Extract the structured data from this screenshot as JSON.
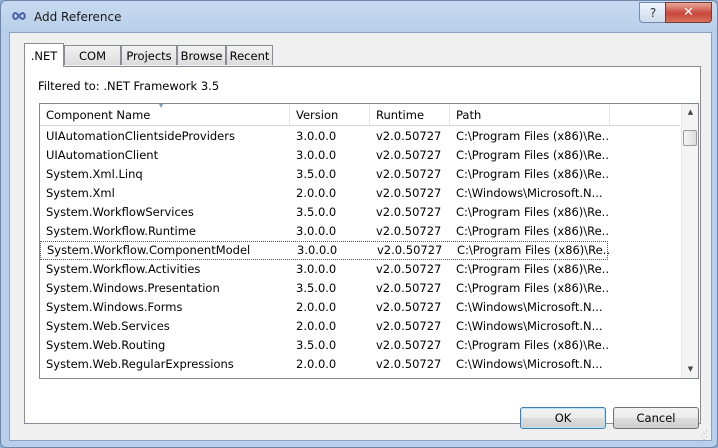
{
  "window": {
    "title": "Add Reference",
    "help_label": "?",
    "close_label": "✕"
  },
  "tabs": [
    {
      "label": ".NET",
      "active": true
    },
    {
      "label": "COM",
      "active": false
    },
    {
      "label": "Projects",
      "active": false
    },
    {
      "label": "Browse",
      "active": false
    },
    {
      "label": "Recent",
      "active": false
    }
  ],
  "filter_text": "Filtered to: .NET Framework 3.5",
  "list": {
    "columns": [
      "Component Name",
      "Version",
      "Runtime",
      "Path"
    ],
    "rows": [
      [
        "UIAutomationClientsideProviders",
        "3.0.0.0",
        "v2.0.50727",
        "C:\\Program Files (x86)\\Re..."
      ],
      [
        "UIAutomationClient",
        "3.0.0.0",
        "v2.0.50727",
        "C:\\Program Files (x86)\\Re..."
      ],
      [
        "System.Xml.Linq",
        "3.5.0.0",
        "v2.0.50727",
        "C:\\Program Files (x86)\\Re..."
      ],
      [
        "System.Xml",
        "2.0.0.0",
        "v2.0.50727",
        "C:\\Windows\\Microsoft.N..."
      ],
      [
        "System.WorkflowServices",
        "3.5.0.0",
        "v2.0.50727",
        "C:\\Program Files (x86)\\Re..."
      ],
      [
        "System.Workflow.Runtime",
        "3.0.0.0",
        "v2.0.50727",
        "C:\\Program Files (x86)\\Re..."
      ],
      [
        "System.Workflow.ComponentModel",
        "3.0.0.0",
        "v2.0.50727",
        "C:\\Program Files (x86)\\Re..."
      ],
      [
        "System.Workflow.Activities",
        "3.0.0.0",
        "v2.0.50727",
        "C:\\Program Files (x86)\\Re..."
      ],
      [
        "System.Windows.Presentation",
        "3.5.0.0",
        "v2.0.50727",
        "C:\\Program Files (x86)\\Re..."
      ],
      [
        "System.Windows.Forms",
        "2.0.0.0",
        "v2.0.50727",
        "C:\\Windows\\Microsoft.N..."
      ],
      [
        "System.Web.Services",
        "2.0.0.0",
        "v2.0.50727",
        "C:\\Windows\\Microsoft.N..."
      ],
      [
        "System.Web.Routing",
        "3.5.0.0",
        "v2.0.50727",
        "C:\\Program Files (x86)\\Re..."
      ],
      [
        "System.Web.RegularExpressions",
        "2.0.0.0",
        "v2.0.50727",
        "C:\\Windows\\Microsoft.N..."
      ]
    ],
    "selected_index": 6,
    "sorted_column": "Component Name"
  },
  "buttons": {
    "ok": "OK",
    "cancel": "Cancel"
  },
  "colors": {
    "title_bar": "#c7daf0",
    "close_button": "#c9463a",
    "default_button_border": "#3c7fb1"
  },
  "icons": {
    "app": "infinity-icon",
    "sort": "sort-ascending-icon",
    "scroll_up": "scroll-up-arrow-icon",
    "scroll_down": "scroll-down-arrow-icon",
    "grip": "size-grip-icon"
  }
}
